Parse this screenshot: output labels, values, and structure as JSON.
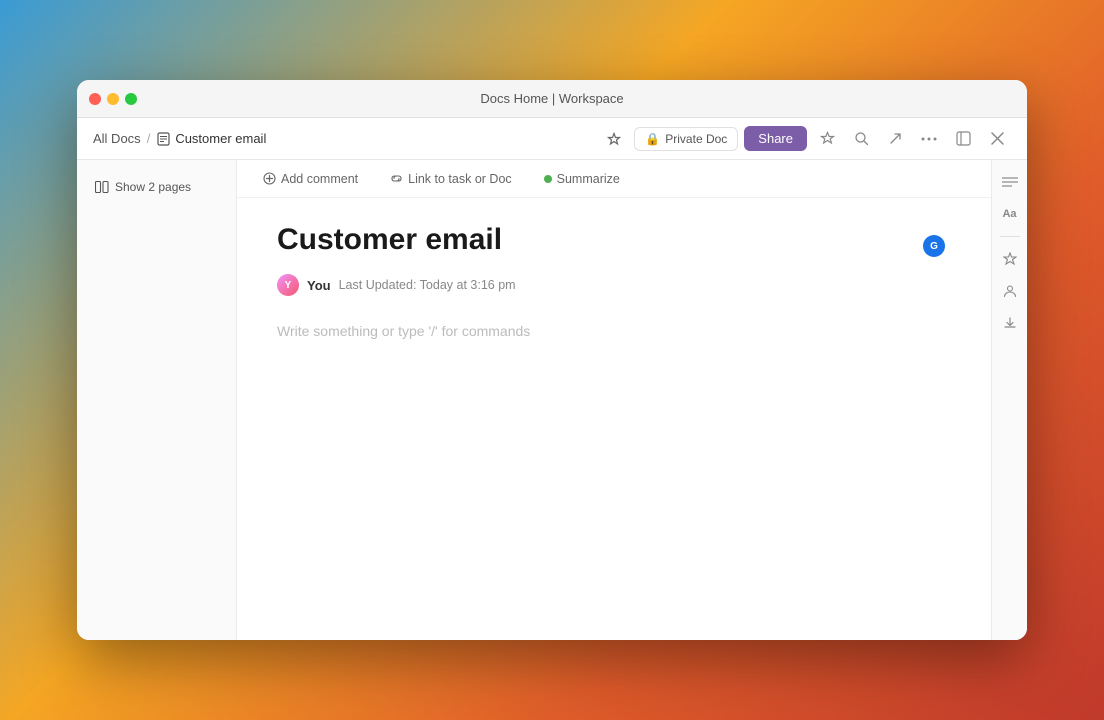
{
  "titlebar": {
    "title": "Docs Home | Workspace"
  },
  "breadcrumb": {
    "all_docs_label": "All Docs",
    "separator": "/",
    "current_doc": "Customer email"
  },
  "toolbar": {
    "private_doc_label": "Private Doc",
    "share_label": "Share",
    "lock_icon": "🔒",
    "star_icon": "☆",
    "search_icon": "⌕",
    "export_icon": "↗",
    "more_icon": "···",
    "collapse_icon": "⊠",
    "close_icon": "✕"
  },
  "sidebar": {
    "show_pages_label": "Show 2 pages"
  },
  "editor_toolbar": {
    "add_comment_label": "Add comment",
    "link_task_label": "Link to task or Doc",
    "summarize_label": "Summarize",
    "comment_icon": "💬",
    "link_icon": "🔗"
  },
  "doc": {
    "title": "Customer email",
    "author": "You",
    "last_updated_label": "Last Updated: Today at 3:16 pm",
    "placeholder": "Write something or type '/' for commands"
  },
  "right_sidebar": {
    "font_icon": "Aa",
    "star_icon": "✦",
    "person_icon": "👤",
    "download_icon": "⤓"
  },
  "ai_indicator": {
    "letter": "G"
  }
}
